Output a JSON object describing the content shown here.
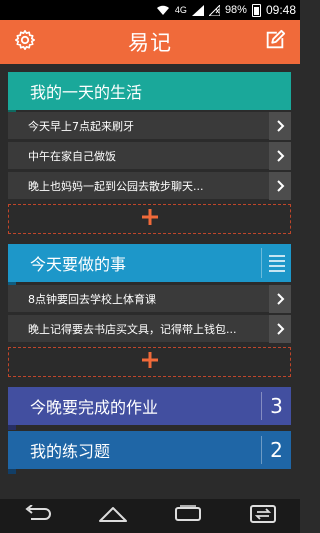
{
  "status_bar": {
    "network": "4G",
    "battery": "98%",
    "time": "09:48"
  },
  "app_bar": {
    "title": "易记",
    "settings_icon": "gear-icon",
    "edit_icon": "edit-icon"
  },
  "groups": [
    {
      "title": "我的一天的生活",
      "color": "#1aa89a",
      "items": [
        "今天早上7点起来刷牙",
        "中午在家自己做饭",
        "晚上也妈妈一起到公园去散步聊天..."
      ],
      "add_symbol": "+"
    },
    {
      "title": "今天要做的事",
      "color": "#1d97c9",
      "items": [
        "8点钟要回去学校上体育课",
        "晚上记得要去书店买文具，记得带上钱包..."
      ],
      "add_symbol": "+"
    },
    {
      "title": "今晚要完成的作业",
      "color": "#424fa0",
      "count": "3"
    },
    {
      "title": "我的练习题",
      "color": "#1f66a6",
      "count": "2"
    }
  ],
  "accent_color": "#f06a3a"
}
